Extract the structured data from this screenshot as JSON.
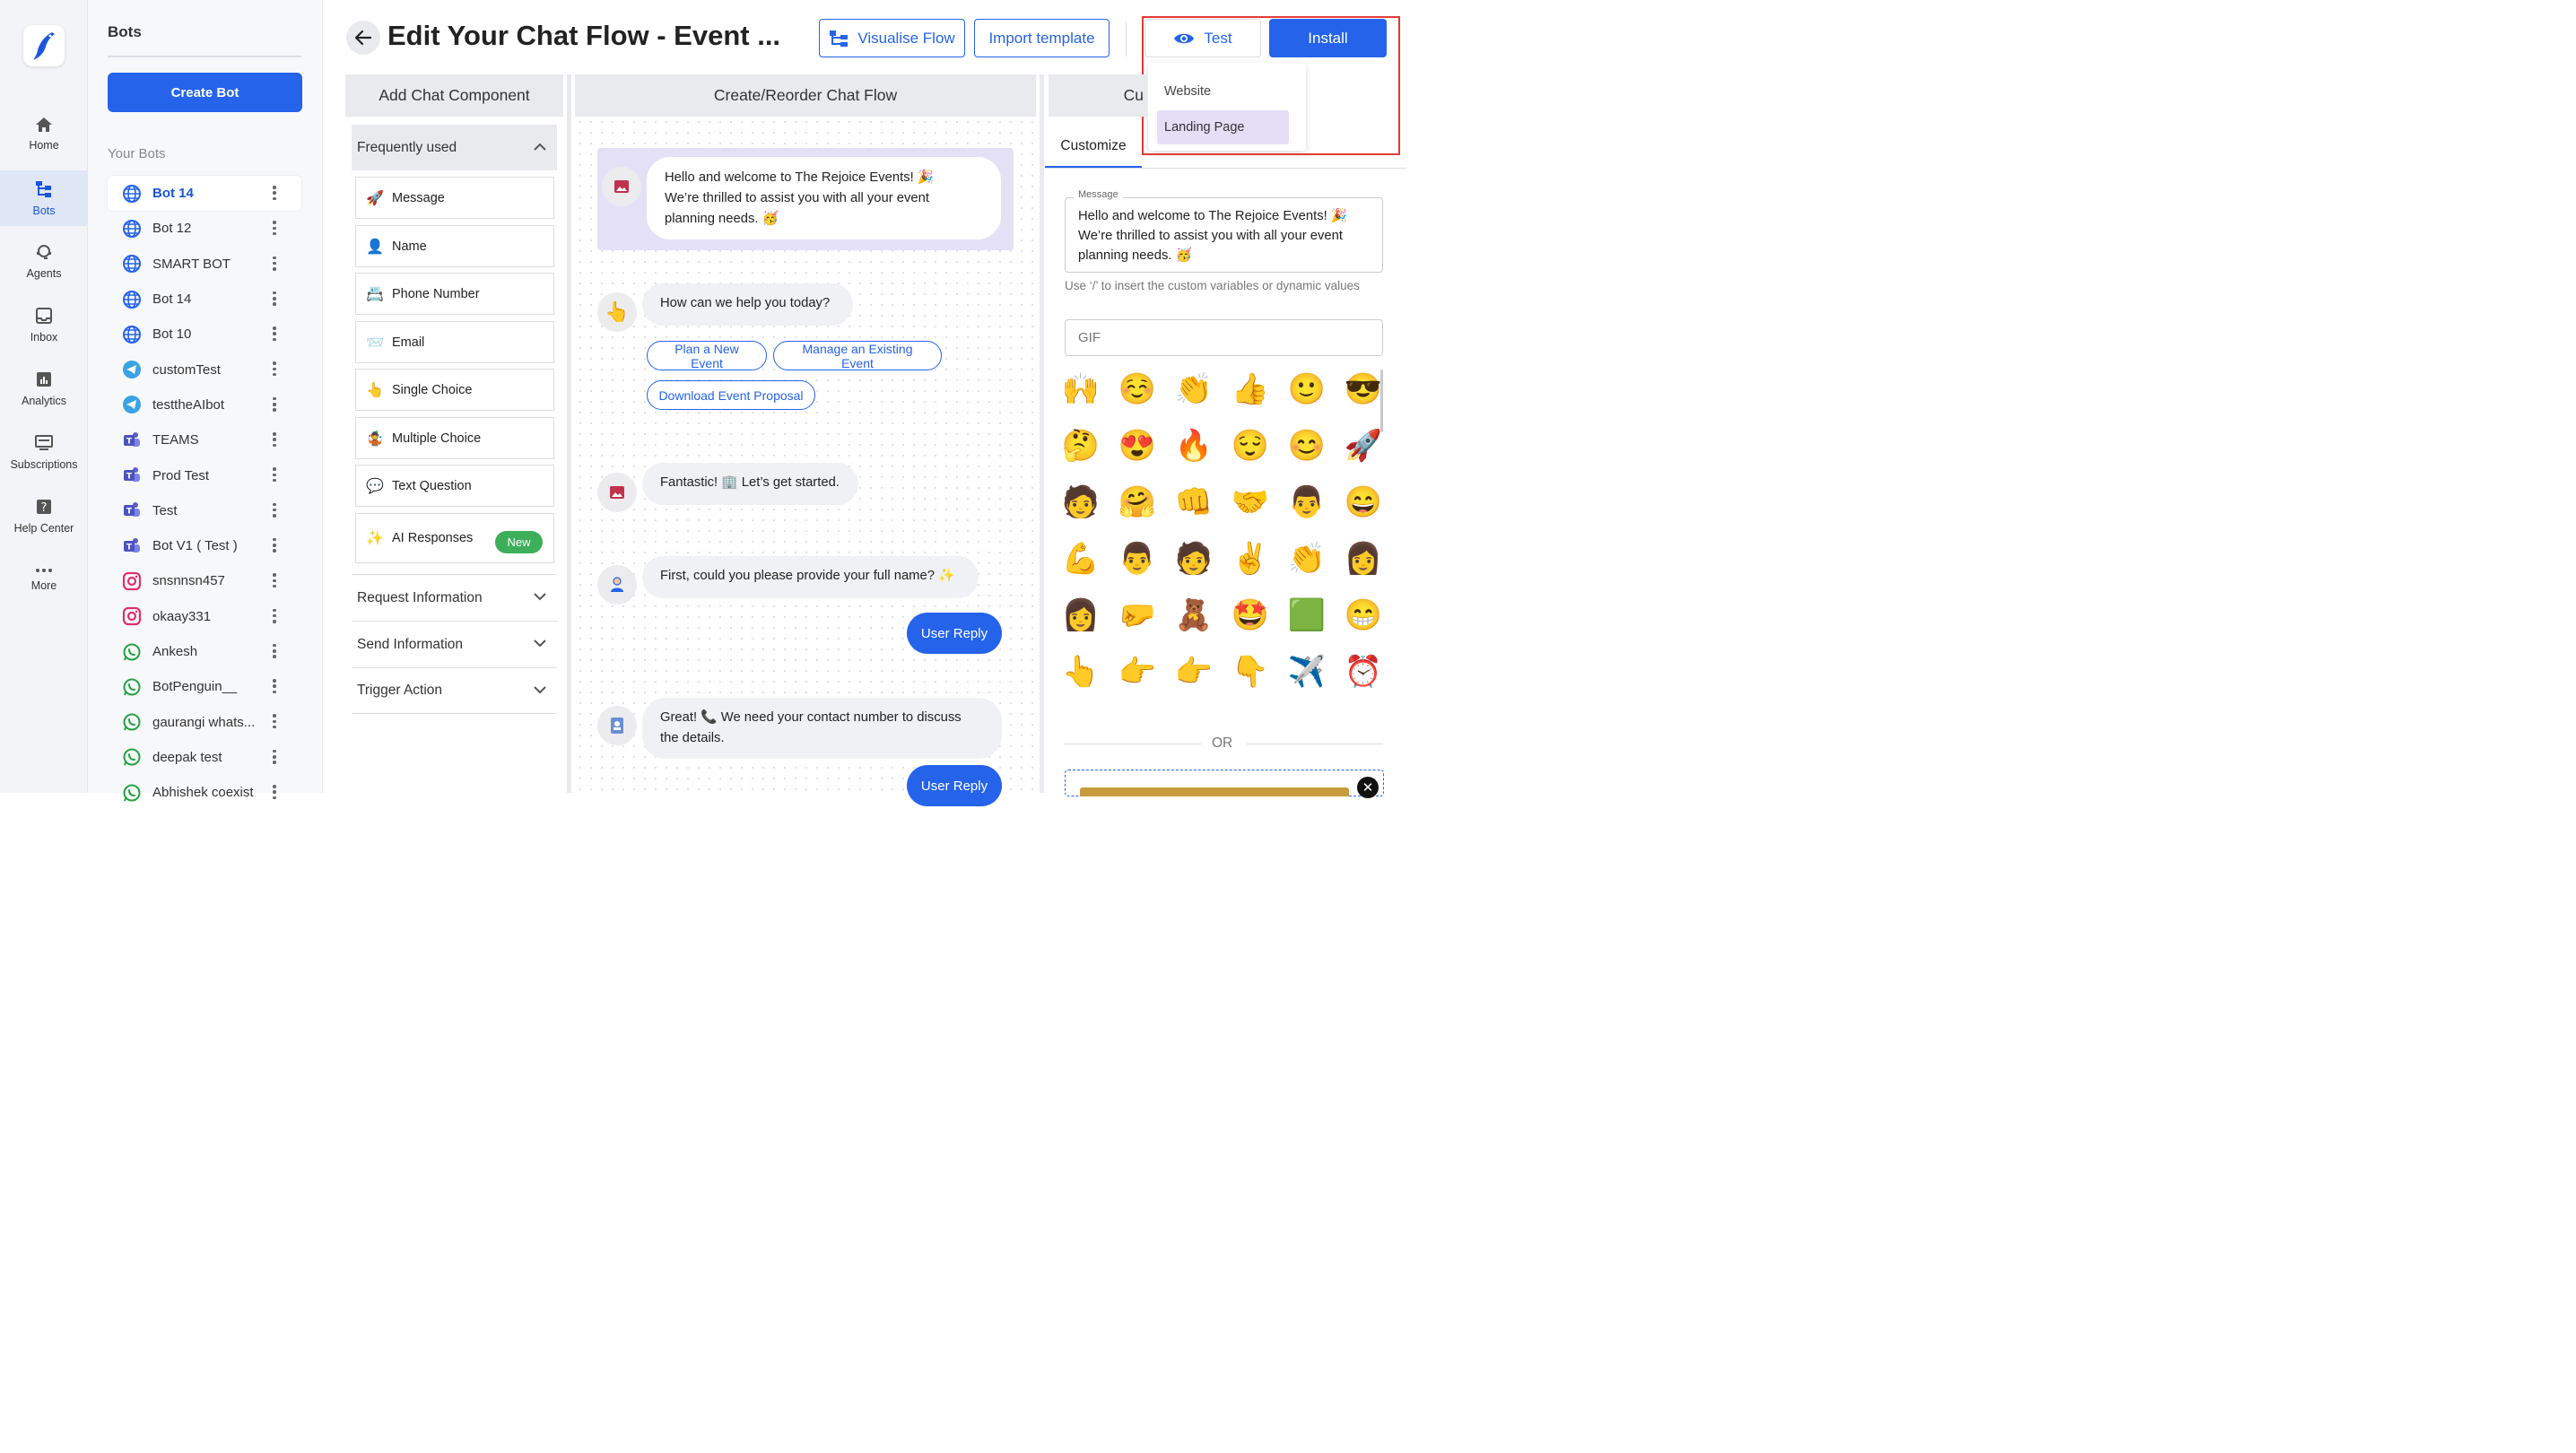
{
  "nav": {
    "items": [
      {
        "label": "Home",
        "icon": "home-icon"
      },
      {
        "label": "Bots",
        "icon": "bots-icon"
      },
      {
        "label": "Agents",
        "icon": "agents-icon"
      },
      {
        "label": "Inbox",
        "icon": "inbox-icon"
      },
      {
        "label": "Analytics",
        "icon": "analytics-icon"
      },
      {
        "label": "Subscriptions",
        "icon": "subscriptions-icon"
      },
      {
        "label": "Help Center",
        "icon": "help-icon"
      },
      {
        "label": "More",
        "icon": "more-icon"
      }
    ],
    "active": "Bots"
  },
  "sidebar": {
    "title": "Bots",
    "create_label": "Create Bot",
    "section_label": "Your Bots",
    "bots": [
      {
        "name": "Bot 14",
        "type": "web"
      },
      {
        "name": "Bot 12",
        "type": "web"
      },
      {
        "name": "SMART BOT",
        "type": "web"
      },
      {
        "name": "Bot 14",
        "type": "web"
      },
      {
        "name": "Bot 10",
        "type": "web"
      },
      {
        "name": "customTest",
        "type": "telegram"
      },
      {
        "name": "testtheAIbot",
        "type": "telegram"
      },
      {
        "name": "TEAMS",
        "type": "teams"
      },
      {
        "name": "Prod Test",
        "type": "teams"
      },
      {
        "name": "Test",
        "type": "teams"
      },
      {
        "name": "Bot V1 ( Test )",
        "type": "teams"
      },
      {
        "name": "snsnnsn457",
        "type": "instagram"
      },
      {
        "name": "okaay331",
        "type": "instagram"
      },
      {
        "name": "Ankesh",
        "type": "whatsapp"
      },
      {
        "name": "BotPenguin__",
        "type": "whatsapp"
      },
      {
        "name": "gaurangi whats...",
        "type": "whatsapp"
      },
      {
        "name": "deepak test",
        "type": "whatsapp"
      },
      {
        "name": "Abhishek coexist",
        "type": "whatsapp"
      }
    ]
  },
  "header": {
    "title": "Edit Your Chat Flow - Event ...",
    "visualise_label": "Visualise Flow",
    "import_label": "Import template",
    "test_label": "Test",
    "install_label": "Install",
    "dropdown": [
      "Website",
      "Landing Page"
    ],
    "dropdown_selected": "Landing Page"
  },
  "columns": {
    "components": "Add Chat Component",
    "flow": "Create/Reorder Chat Flow",
    "customize": "Cu"
  },
  "components": {
    "group_label": "Frequently used",
    "items": [
      {
        "label": "Message",
        "icon": "message-icon",
        "glyph": "🚀"
      },
      {
        "label": "Name",
        "icon": "name-icon",
        "glyph": "👤"
      },
      {
        "label": "Phone Number",
        "icon": "phone-icon",
        "glyph": "📇"
      },
      {
        "label": "Email",
        "icon": "email-icon",
        "glyph": "📨"
      },
      {
        "label": "Single Choice",
        "icon": "single-choice-icon",
        "glyph": "👆"
      },
      {
        "label": "Multiple Choice",
        "icon": "multiple-choice-icon",
        "glyph": "🤹"
      },
      {
        "label": "Text Question",
        "icon": "text-question-icon",
        "glyph": "💬"
      },
      {
        "label": "AI Responses",
        "icon": "ai-sparkle-icon",
        "glyph": "✨",
        "badge": "New"
      }
    ],
    "sections": [
      "Request Information",
      "Send Information",
      "Trigger Action"
    ]
  },
  "flow": {
    "msg1_line1": "Hello and welcome to The Rejoice Events! 🎉",
    "msg1_line2": "We’re thrilled to assist you with all your event",
    "msg1_line3": "planning needs. 🥳",
    "msg2": "How can we help you today?",
    "choices": [
      "Plan a New Event",
      "Manage an Existing Event",
      "Download Event Proposal"
    ],
    "msg3": "Fantastic! 🏢 Let’s get started.",
    "msg4": "First, could you please provide your full name? ✨",
    "user_reply": "User Reply",
    "msg5_line1": "Great! 📞 We need your contact number to discuss",
    "msg5_line2": "the details."
  },
  "customize": {
    "tab_label": "Customize",
    "message_legend": "Message",
    "message_line1": "Hello and welcome to The Rejoice Events! 🎉",
    "message_line2": "We’re thrilled to assist you with all your event",
    "message_line3": "planning needs. 🥳",
    "helper": "Use ‘/’ to insert the custom variables or dynamic values",
    "gif_placeholder": "GIF",
    "emojis": [
      "🙌",
      "☺️",
      "👏",
      "👍",
      "🙂",
      "😎",
      "🤔",
      "😍",
      "🔥",
      "😌",
      "😊",
      "🚀",
      "🧑",
      "🤗",
      "👊",
      "🤝",
      "👨",
      "😄",
      "💪",
      "👨",
      "🧑",
      "✌️",
      "👏",
      "👩",
      "👩",
      "🤛",
      "🧸",
      "🤩",
      "🟩",
      "😁",
      "👆",
      "👉",
      "👉",
      "👇",
      "✈️",
      "⏰"
    ],
    "or_label": "OR",
    "close_glyph": "✕"
  },
  "colors": {
    "primary": "#2563eb",
    "highlight": "#e53935",
    "selected_item": "#e4def7",
    "flow_highlight": "#e4e1f6",
    "new_badge": "#3dae5a"
  }
}
